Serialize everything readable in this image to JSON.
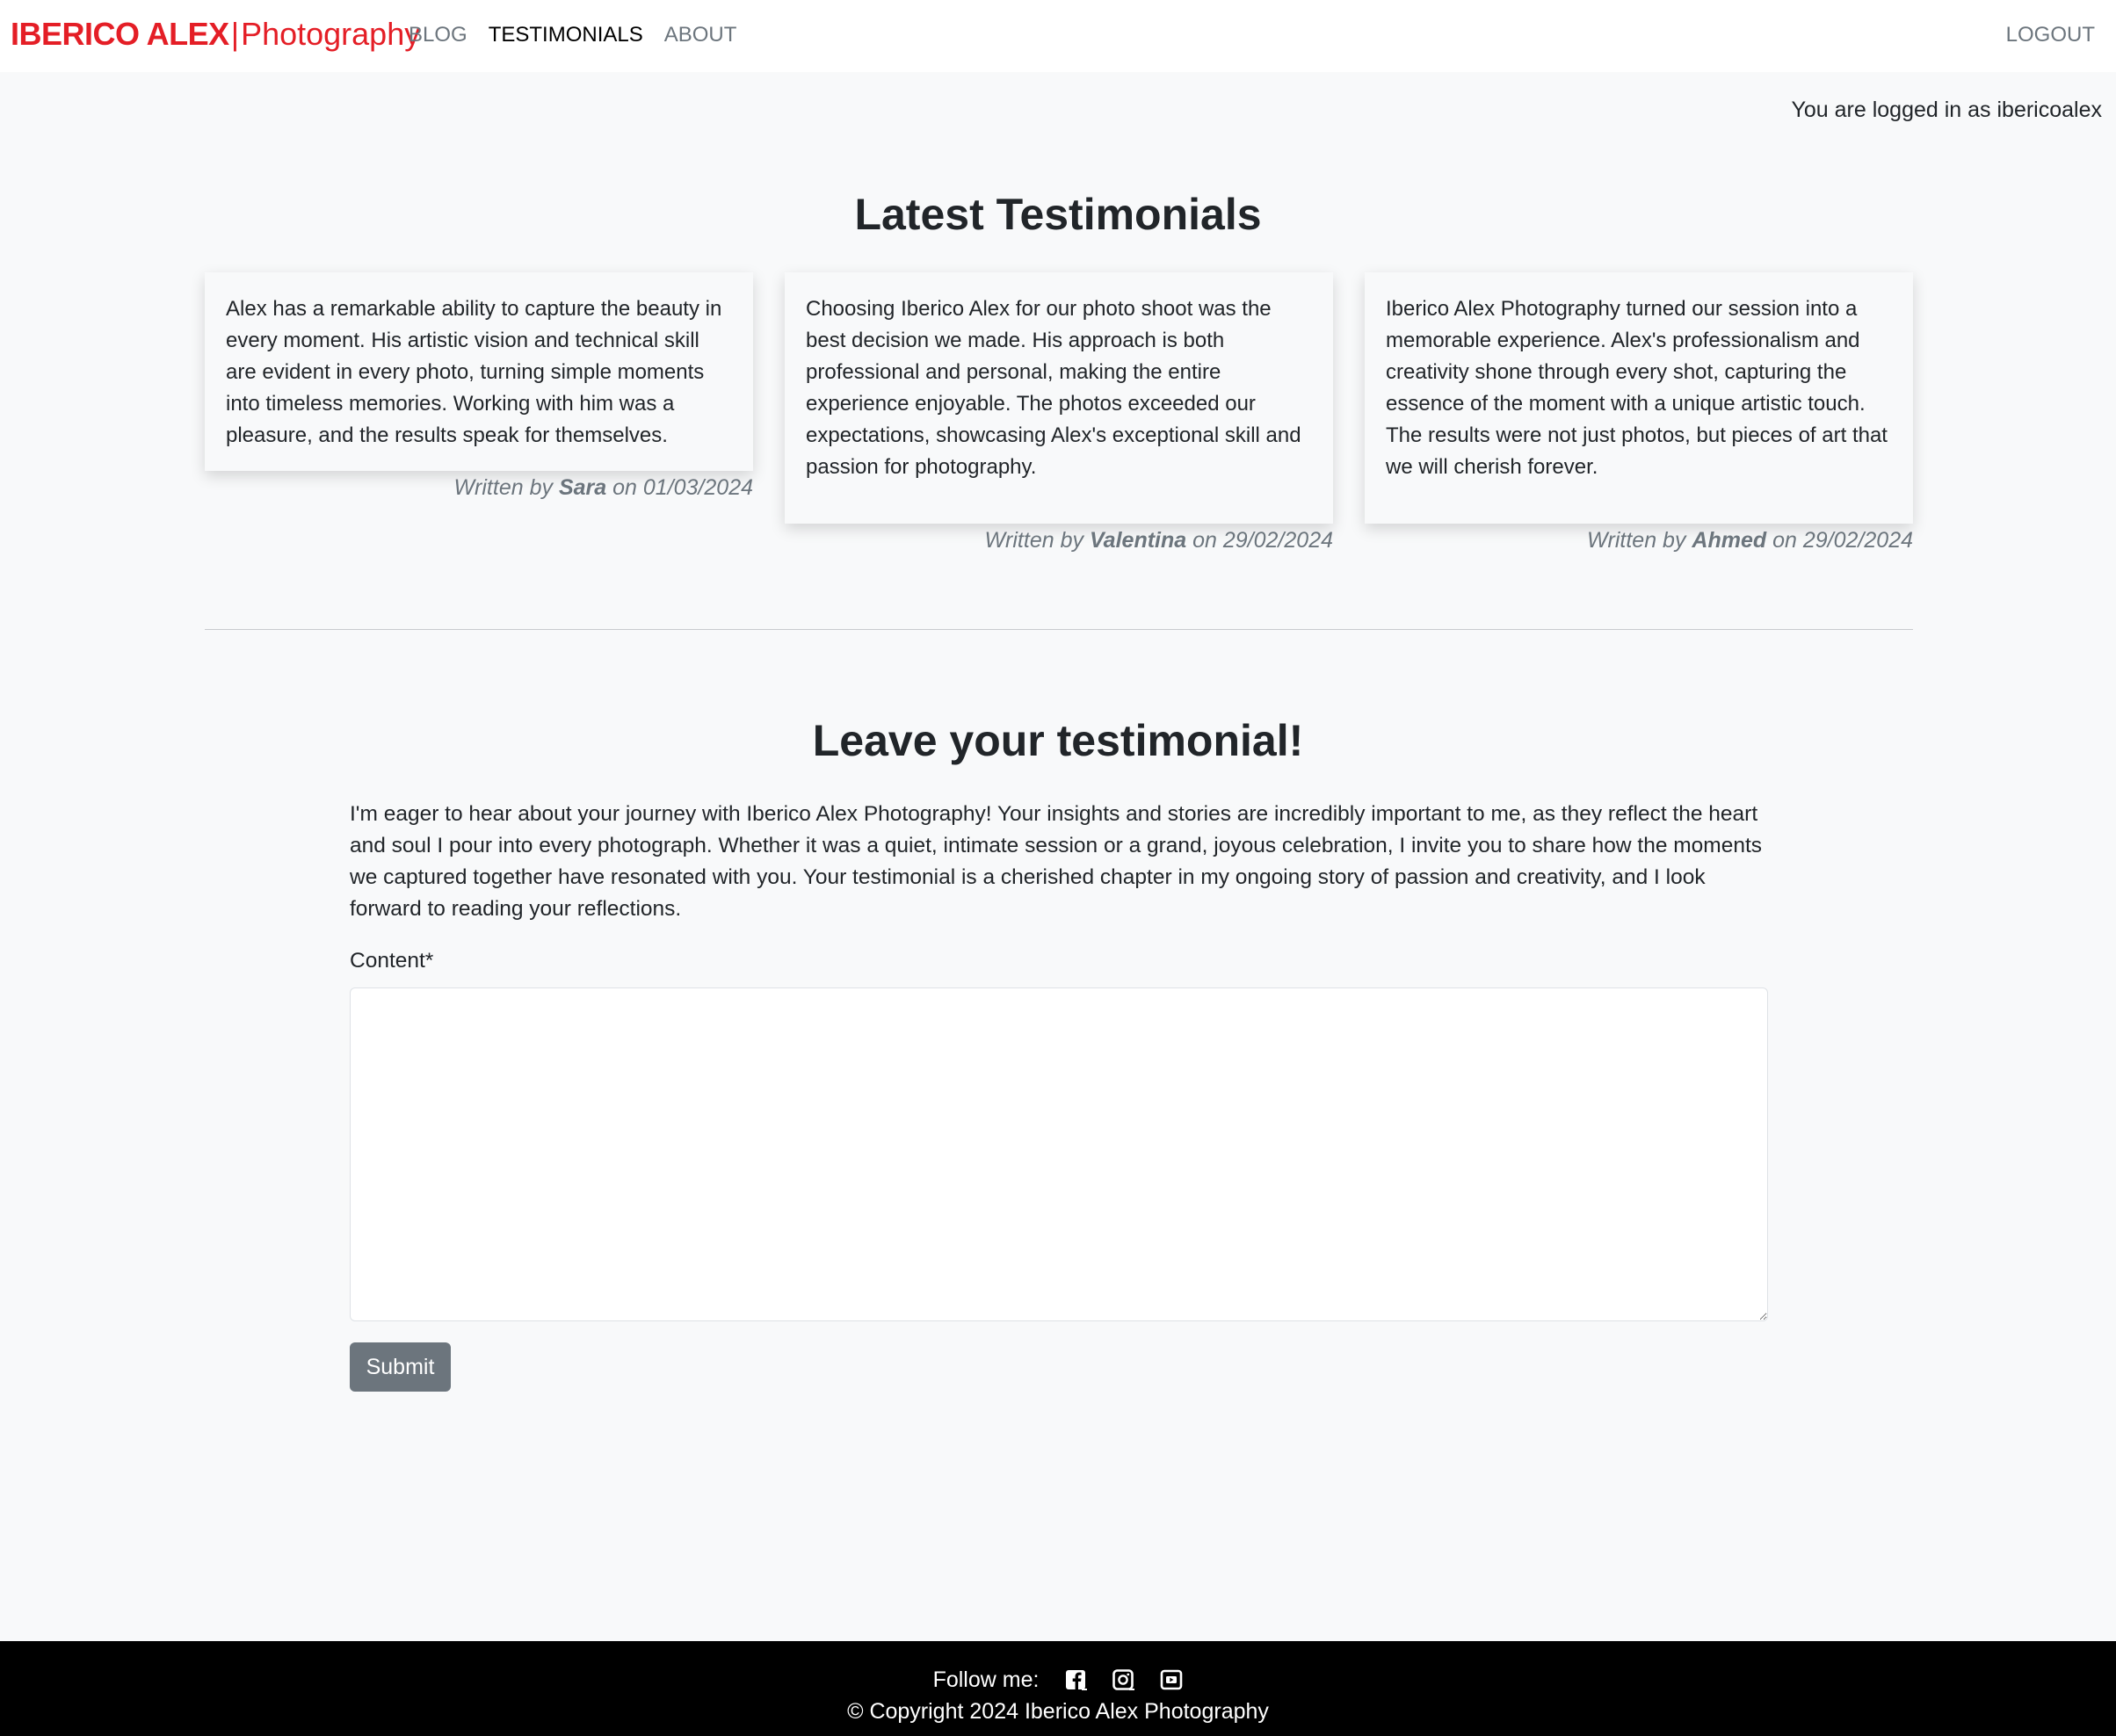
{
  "brand": {
    "bold": "IBERICO ALEX",
    "separator": "|",
    "light": "Photography",
    "color": "#e41e26"
  },
  "nav": {
    "items": [
      "BLOG",
      "TESTIMONIALS",
      "ABOUT"
    ],
    "active": "TESTIMONIALS",
    "logout": "LOGOUT"
  },
  "user": {
    "status": "You are logged in as ibericoalex"
  },
  "latest": {
    "title": "Latest Testimonials",
    "testimonials": [
      {
        "text": "Alex has a remarkable ability to capture the beauty in every moment. His artistic vision and technical skill are evident in every photo, turning simple moments into timeless memories. Working with him was a pleasure, and the results speak for themselves.",
        "written_by": "Written by",
        "author": "Sara",
        "on": "on",
        "date": "01/03/2024"
      },
      {
        "text": "Choosing Iberico Alex for our photo shoot was the best decision we made. His approach is both professional and personal, making the entire experience enjoyable. The photos exceeded our expectations, showcasing Alex's exceptional skill and passion for photography.",
        "written_by": "Written by",
        "author": "Valentina",
        "on": "on",
        "date": "29/02/2024"
      },
      {
        "text": "Iberico Alex Photography turned our session into a memorable experience. Alex's professionalism and creativity shone through every shot, capturing the essence of the moment with a unique artistic touch. The results were not just photos, but pieces of art that we will cherish forever.",
        "written_by": "Written by",
        "author": "Ahmed",
        "on": "on",
        "date": "29/02/2024"
      }
    ]
  },
  "leave": {
    "title": "Leave your testimonial!",
    "intro": "I'm eager to hear about your journey with Iberico Alex Photography! Your insights and stories are incredibly important to me, as they reflect the heart and soul I pour into every photograph. Whether it was a quiet, intimate session or a grand, joyous celebration, I invite you to share how the moments we captured together have resonated with you. Your testimonial is a cherished chapter in my ongoing story of passion and creativity, and I look forward to reading your reflections.",
    "content_label": "Content*",
    "content_value": "",
    "submit_label": "Submit"
  },
  "footer": {
    "follow": "Follow me:",
    "icons": [
      "facebook-icon",
      "instagram-icon",
      "youtube-icon"
    ],
    "copyright": "© Copyright 2024 Iberico Alex Photography"
  }
}
